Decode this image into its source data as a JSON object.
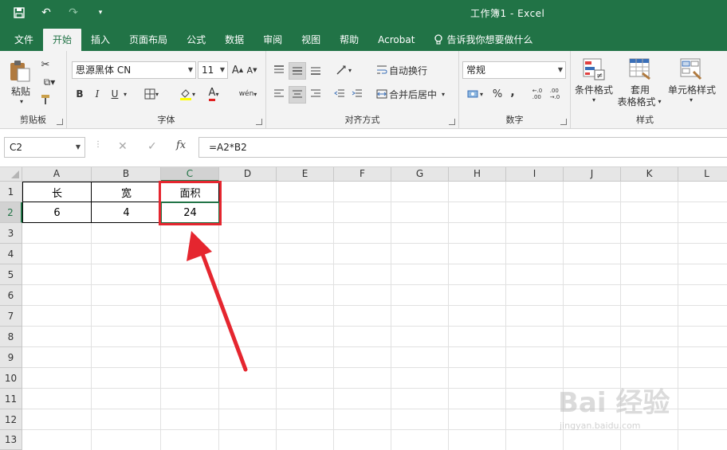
{
  "window": {
    "title": "工作簿1  -  Excel"
  },
  "tabs": [
    "文件",
    "开始",
    "插入",
    "页面布局",
    "公式",
    "数据",
    "审阅",
    "视图",
    "帮助",
    "Acrobat"
  ],
  "active_tab": "开始",
  "tell_me": "告诉我你想要做什么",
  "ribbon": {
    "clipboard": {
      "paste": "粘贴",
      "label": "剪贴板"
    },
    "font": {
      "name": "思源黑体 CN",
      "size": "11",
      "bold": "B",
      "italic": "I",
      "underline": "U",
      "phonetic": "wén",
      "label": "字体"
    },
    "align": {
      "wrap": "自动换行",
      "merge": "合并后居中",
      "label": "对齐方式"
    },
    "number": {
      "format": "常规",
      "percent": "%",
      "comma": ",",
      "label": "数字"
    },
    "styles": {
      "cond": "条件格式",
      "table1": "套用",
      "table2": "表格格式",
      "cell": "单元格样式",
      "label": "样式"
    }
  },
  "formula_bar": {
    "name_box": "C2",
    "formula": "=A2*B2"
  },
  "columns": [
    "A",
    "B",
    "C",
    "D",
    "E",
    "F",
    "G",
    "H",
    "I",
    "J",
    "K",
    "L"
  ],
  "rows": [
    "1",
    "2",
    "3",
    "4",
    "5",
    "6",
    "7",
    "8",
    "9",
    "10",
    "11",
    "12",
    "13"
  ],
  "cells": {
    "A1": "长",
    "B1": "宽",
    "C1": "面积",
    "A2": "6",
    "B2": "4",
    "C2": "24"
  },
  "watermark": {
    "brand": "Bai 经验",
    "url": "jingyan.baidu.com"
  },
  "colors": {
    "accent": "#217346",
    "annotation": "#e5262f"
  }
}
